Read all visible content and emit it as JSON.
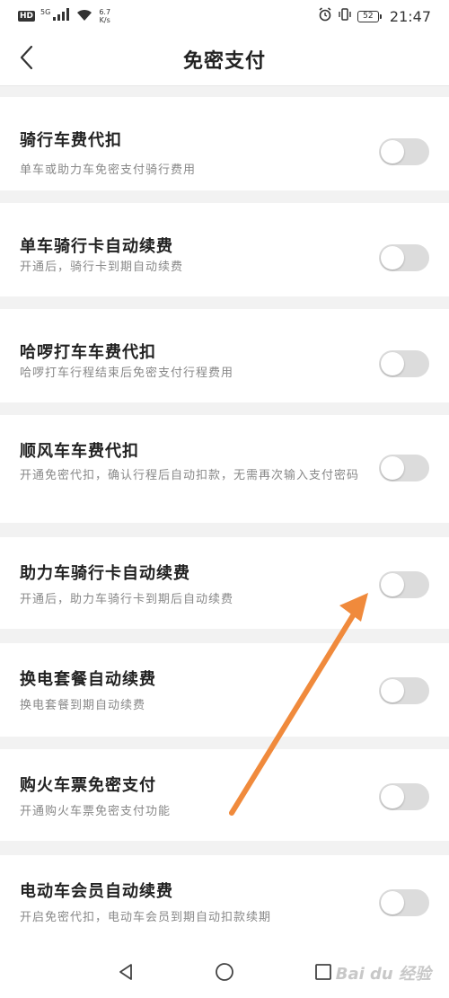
{
  "status_bar": {
    "hd": "HD",
    "signal_label": "5G",
    "net_speed_value": "6.7",
    "net_speed_unit": "K/s",
    "battery": "52",
    "time": "21:47"
  },
  "header": {
    "title": "免密支付"
  },
  "settings": [
    {
      "title": "骑行车费代扣",
      "desc": "单车或助力车免密支付骑行费用",
      "enabled": false
    },
    {
      "title": "单车骑行卡自动续费",
      "desc": "开通后，骑行卡到期自动续费",
      "enabled": false
    },
    {
      "title": "哈啰打车车费代扣",
      "desc": "哈啰打车行程结束后免密支付行程费用",
      "enabled": false
    },
    {
      "title": "顺风车车费代扣",
      "desc": "开通免密代扣，确认行程后自动扣款，无需再次输入支付密码",
      "enabled": false
    },
    {
      "title": "助力车骑行卡自动续费",
      "desc": "开通后，助力车骑行卡到期后自动续费",
      "enabled": false
    },
    {
      "title": "换电套餐自动续费",
      "desc": "换电套餐到期自动续费",
      "enabled": false
    },
    {
      "title": "购火车票免密支付",
      "desc": "开通购火车票免密支付功能",
      "enabled": false
    },
    {
      "title": "电动车会员自动续费",
      "desc": "开启免密代扣，电动车会员到期自动扣款续期",
      "enabled": false
    }
  ],
  "watermark": "Bai du 经验",
  "colors": {
    "annotation_arrow": "#f08a3c",
    "toggle_off": "#dcdcdc",
    "background": "#f2f2f2"
  }
}
